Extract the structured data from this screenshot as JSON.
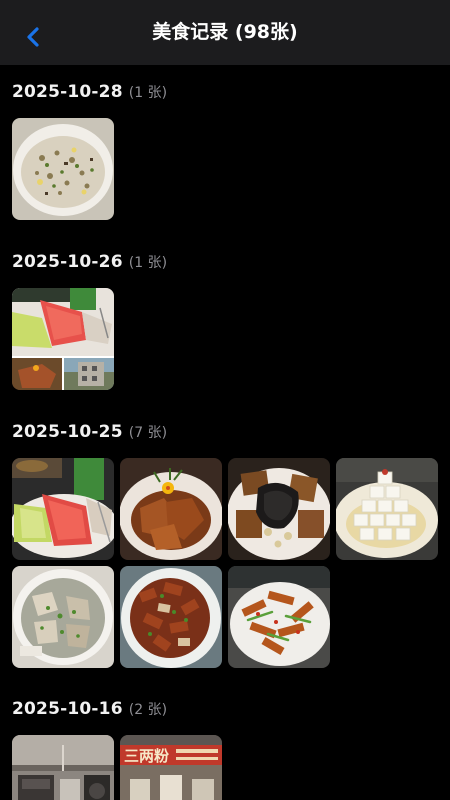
{
  "header": {
    "title": "美食记录 (98张)",
    "back_icon": "chevron-left-icon",
    "accent_color": "#1a73e8"
  },
  "sections": [
    {
      "date": "2025-10-28",
      "count": "(1 张)",
      "photos": [
        "fried-rice"
      ]
    },
    {
      "date": "2025-10-26",
      "count": "(1 张)",
      "photos": [
        "collage-fruit"
      ]
    },
    {
      "date": "2025-10-25",
      "count": "(7 张)",
      "photos": [
        "watermelon-plate",
        "braised-pork-flower",
        "wood-ear-tofu",
        "tofu-tower",
        "pork-bone-soup",
        "stir-fried-meat",
        "fried-dish-greens"
      ]
    },
    {
      "date": "2025-10-16",
      "count": "(2 张)",
      "photos": [
        "kitchen",
        "restaurant-sign"
      ]
    }
  ],
  "sign_text": "三两粉"
}
